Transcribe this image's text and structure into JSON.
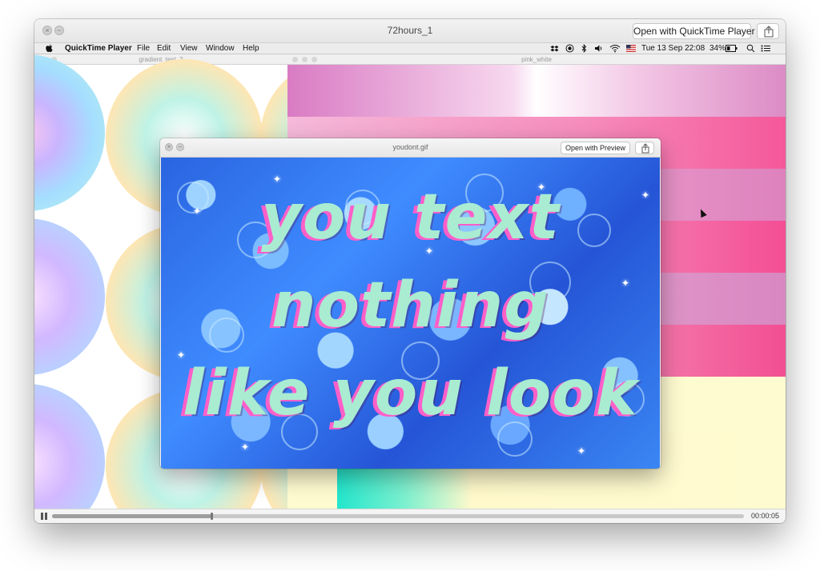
{
  "window": {
    "title": "72hours_1",
    "open_button": "Open with QuickTime Player"
  },
  "menubar": {
    "app_name": "QuickTime Player",
    "menus": [
      "File",
      "Edit",
      "View",
      "Window",
      "Help"
    ],
    "date_time": "Tue 13 Sep  22:08",
    "battery": "34%"
  },
  "windows": {
    "gradient": {
      "title": "gradient_test_2"
    },
    "pink": {
      "title": "pink_white"
    },
    "gif": {
      "title": "youdont.gif",
      "open_button": "Open with Preview",
      "lines": [
        "you text",
        "nothing",
        "like you look"
      ]
    }
  },
  "player": {
    "elapsed": "00:00:05",
    "progress": 0.23
  },
  "colors": {
    "gif_text": "#a9ecd2",
    "gif_text_shadow": "#ff5fc9",
    "roses": "#3f8cff"
  }
}
